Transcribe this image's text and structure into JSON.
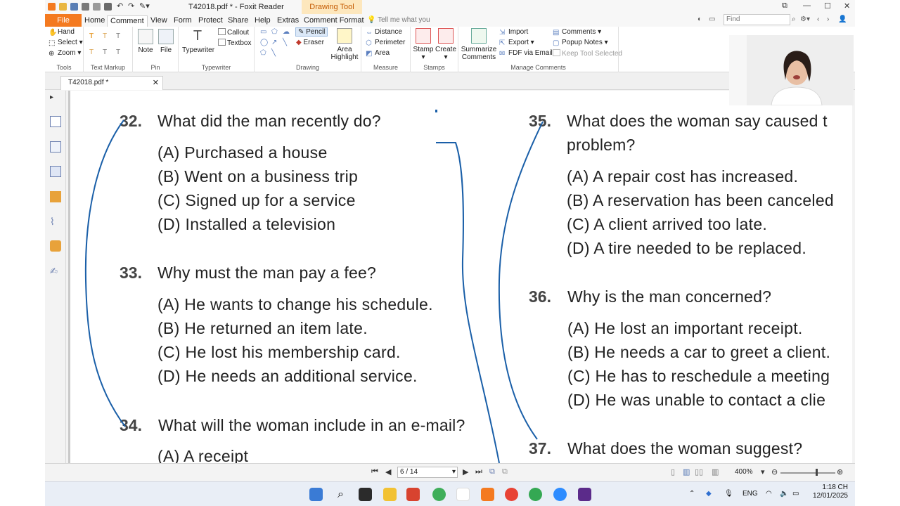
{
  "window": {
    "title": "T42018.pdf * - Foxit Reader",
    "contextual_tab": "Drawing Tool",
    "find_placeholder": "Find"
  },
  "tabs": {
    "file": "File",
    "items": [
      "Home",
      "Comment",
      "View",
      "Form",
      "Protect",
      "Share",
      "Help",
      "Extras",
      "Comment Format"
    ],
    "active": "Comment",
    "tell_me": "Tell me what you"
  },
  "ribbon": {
    "tools": {
      "label": "Tools",
      "hand": "Hand",
      "select": "Select",
      "zoom": "Zoom"
    },
    "text_markup": {
      "label": "Text Markup"
    },
    "pin": {
      "label": "Pin",
      "note": "Note",
      "file": "File"
    },
    "typewriter": {
      "label": "Typewriter",
      "typewriter": "Typewriter",
      "callout": "Callout",
      "textbox": "Textbox"
    },
    "drawing": {
      "label": "Drawing",
      "pencil": "Pencil",
      "eraser": "Eraser",
      "area_highlight_1": "Area",
      "area_highlight_2": "Highlight"
    },
    "measure": {
      "label": "Measure",
      "distance": "Distance",
      "perimeter": "Perimeter",
      "area": "Area"
    },
    "stamps": {
      "label": "Stamps",
      "stamp": "Stamp",
      "create": "Create"
    },
    "manage": {
      "label": "Manage Comments",
      "summarize_1": "Summarize",
      "summarize_2": "Comments",
      "import": "Import",
      "export": "Export",
      "fdf": "FDF via Email",
      "comments": "Comments",
      "popup_notes": "Popup Notes",
      "keep_tool": "Keep Tool Selected"
    }
  },
  "doc_tab": {
    "name": "T42018.pdf *"
  },
  "document": {
    "questions": [
      {
        "num": "32.",
        "text": "What did the man recently do?",
        "options": [
          "(A) Purchased a house",
          "(B) Went on a business trip",
          "(C) Signed up for a service",
          "(D) Installed a television"
        ]
      },
      {
        "num": "33.",
        "text": "Why must the man pay a fee?",
        "options": [
          "(A) He wants to change his schedule.",
          "(B) He returned an item late.",
          "(C) He lost his membership card.",
          "(D) He needs an additional service."
        ]
      },
      {
        "num": "34.",
        "text": "What will the woman include in an e-mail?",
        "options": [
          "(A) A receipt"
        ]
      },
      {
        "num": "35.",
        "text_line1": "What does the woman say caused t",
        "text_line2": "problem?",
        "options": [
          "(A) A repair cost has increased.",
          "(B) A reservation has been canceled",
          "(C) A client arrived too late.",
          "(D) A tire needed to be replaced."
        ]
      },
      {
        "num": "36.",
        "text": "Why is the man concerned?",
        "options": [
          "(A) He lost an important receipt.",
          "(B) He needs a car to greet a client.",
          "(C) He has to reschedule a meeting",
          "(D) He was unable to contact a clie"
        ]
      },
      {
        "num": "37.",
        "text": "What does the woman suggest?"
      }
    ]
  },
  "status": {
    "page": "6 / 14",
    "zoom": "400%"
  },
  "taskbar": {
    "lang": "ENG",
    "time": "1:18 CH",
    "date": "12/01/2025"
  },
  "colors": {
    "accent": "#f47a20",
    "ink": "#1a5fa8"
  }
}
